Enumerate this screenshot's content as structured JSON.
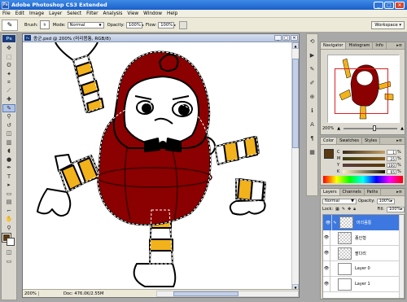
{
  "app": {
    "title": "Adobe Photoshop CS3 Extended",
    "icon_label": "Ps",
    "window_controls": {
      "minimize": "_",
      "maximize": "□",
      "close": "✕"
    }
  },
  "menu": [
    "File",
    "Edit",
    "Image",
    "Layer",
    "Select",
    "Filter",
    "Analysis",
    "View",
    "Window",
    "Help"
  ],
  "options_bar": {
    "brush_label": "Brush:",
    "brush_size": "9",
    "mode_label": "Mode:",
    "mode_value": "Normal",
    "opacity_label": "Opacity:",
    "opacity_value": "100%",
    "flow_label": "Flow:",
    "flow_value": "100%",
    "workspace_label": "Workspace ▾"
  },
  "toolbox": {
    "logo": "Ps",
    "tools": [
      "move-icon",
      "marquee-icon",
      "lasso-icon",
      "magic-wand-icon",
      "crop-icon",
      "slice-icon",
      "healing-icon",
      "brush-icon",
      "clone-stamp-icon",
      "history-brush-icon",
      "eraser-icon",
      "gradient-icon",
      "blur-icon",
      "dodge-icon",
      "pen-icon",
      "type-icon",
      "path-select-icon",
      "shape-icon",
      "notes-icon",
      "eyedropper-icon",
      "hand-icon",
      "zoom-icon"
    ],
    "tool_glyphs": [
      "✥",
      "⬚",
      "ʘ",
      "✦",
      "⌗",
      "⟋",
      "✚",
      "✎",
      "⚲",
      "↺",
      "◫",
      "▥",
      "◖",
      "●",
      "✒",
      "T",
      "▸",
      "▭",
      "▤",
      "⌐",
      "✋",
      "⚲"
    ],
    "active_tool_index": 7,
    "foreground_color": "#5a3a10",
    "background_color": "#ffffff",
    "quickmask_glyph": "◫",
    "screenmode_glyph": "▭"
  },
  "document": {
    "title": "종군.psd @ 200% (머리몸통, RGB/8)",
    "zoom": "200%",
    "info": "Doc: 476.0K/2.55M",
    "controls": {
      "minimize": "_",
      "maximize": "□",
      "close": "✕"
    }
  },
  "dock_icons": [
    "history-icon",
    "actions-icon",
    "tool-presets-icon",
    "brushes-icon",
    "clone-source-icon",
    "info-icon",
    "character-icon",
    "paragraph-icon",
    "layer-comps-icon"
  ],
  "dock_glyphs": [
    "⟲",
    "▶",
    "✎",
    "✐",
    "⊕",
    "ℹ",
    "A",
    "¶",
    "▦"
  ],
  "navigator": {
    "tabs": [
      "Navigator",
      "Histogram",
      "Info"
    ],
    "active_tab": 0,
    "zoom": "200%",
    "slider_value": 0.55,
    "menu_glyph": "▸≡"
  },
  "color_panel": {
    "tabs": [
      "Color",
      "Swatches",
      "Styles"
    ],
    "active_tab": 0,
    "rows": [
      {
        "ch": "C",
        "value": "1",
        "unit": "%",
        "bar": "linear-gradient(90deg,#3a2a18,#c3a06a)"
      },
      {
        "ch": "M",
        "value": "25",
        "unit": "%",
        "bar": "linear-gradient(90deg,#3a3a10,#8a5c18)"
      },
      {
        "ch": "Y",
        "value": "100",
        "unit": "%",
        "bar": "linear-gradient(90deg,#5c3a40,#5a3a08)"
      },
      {
        "ch": "K",
        "value": "65",
        "unit": "%",
        "bar": "linear-gradient(90deg,#fff1c4,#1a1408)"
      }
    ],
    "menu_glyph": "▸≡"
  },
  "layers_panel": {
    "tabs": [
      "Layers",
      "Channels",
      "Paths"
    ],
    "active_tab": 0,
    "blend_mode": "Normal",
    "opacity_label": "Opacity:",
    "opacity_value": "100%",
    "lock_label": "Lock:",
    "fill_label": "Fill:",
    "fill_value": "100%",
    "layers": [
      {
        "name": "머리몸통",
        "selected": true,
        "thumb": "checker"
      },
      {
        "name": "종인형",
        "selected": false,
        "thumb": "checker"
      },
      {
        "name": "팔다리",
        "selected": false,
        "thumb": "checker"
      },
      {
        "name": "Layer 0",
        "selected": false,
        "thumb": "plain"
      },
      {
        "name": "Layer 1",
        "selected": false,
        "thumb": "plain"
      }
    ],
    "menu_glyph": "▸≡"
  },
  "colors": {
    "doll_body": "#8b0000",
    "stripe_yellow": "#f2b21b",
    "stripe_white": "#ffffff",
    "selection_border": "#000000"
  }
}
